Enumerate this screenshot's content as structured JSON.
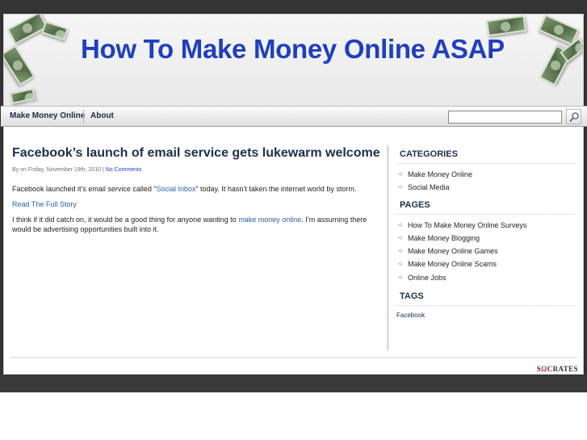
{
  "site": {
    "title": "How To Make Money Online ASAP"
  },
  "nav": {
    "items": [
      {
        "label": "Make Money Online"
      },
      {
        "label": "About"
      }
    ]
  },
  "search": {
    "value": "",
    "button_icon": "search-icon"
  },
  "post": {
    "title": "Facebook’s launch of email service gets lukewarm welcome",
    "meta_text": "By on Friday, November 19th, 2010 | ",
    "meta_comments": "No Comments",
    "p1_before": "Facebook launched it’s email service called “",
    "p1_link": "Social Inbox",
    "p1_after": "” today.  It hasn’t taken the internet world by storm.",
    "read_more": "Read The Full Story",
    "p2_before": "I think if it did catch on, it would be a good thing for anyone wanting to ",
    "p2_link": "make money online",
    "p2_after": ".  I’m assuming there would be advertising opportunities built into it."
  },
  "sidebar": {
    "categories_title": "CATEGORIES",
    "categories": [
      {
        "label": "Make Money Online"
      },
      {
        "label": "Social Media"
      }
    ],
    "pages_title": "PAGES",
    "pages": [
      {
        "label": "How To Make Money Online Surveys"
      },
      {
        "label": "Make Money Blogging"
      },
      {
        "label": "Make Money Online Games"
      },
      {
        "label": "Make Money Online Scams"
      },
      {
        "label": "Online Jobs"
      }
    ],
    "tags_title": "TAGS",
    "tags": [
      {
        "label": "Facebook"
      }
    ]
  },
  "footer": {
    "credit_before": "S",
    "credit_omega": "Ω",
    "credit_after": "CRATES"
  },
  "colors": {
    "title_blue": "#1f3fbf",
    "link_blue": "#2b5ea8",
    "heading_navy": "#1b2f4d",
    "backdrop": "#353535"
  }
}
